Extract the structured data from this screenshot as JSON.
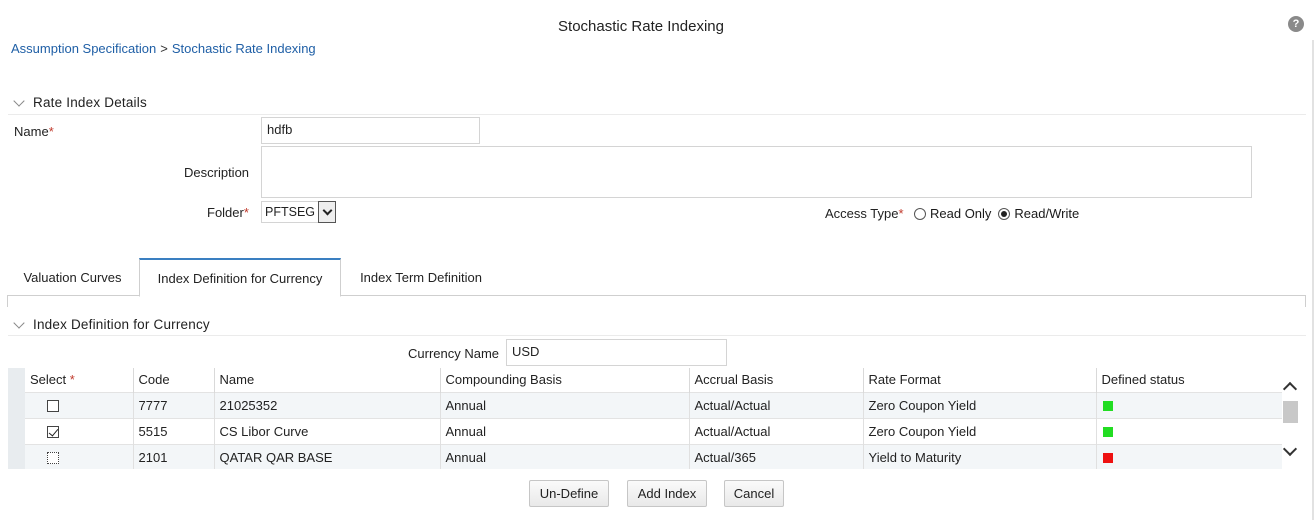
{
  "page": {
    "title": "Stochastic Rate Indexing",
    "help_icon": "?"
  },
  "breadcrumb": {
    "items": [
      "Assumption Specification",
      "Stochastic Rate Indexing"
    ],
    "separator": ">"
  },
  "rate_index_details": {
    "header": "Rate Index Details",
    "name_label": "Name",
    "name_value": "hdfb",
    "description_label": "Description",
    "description_value": "",
    "folder_label": "Folder",
    "folder_value": "PFTSEG",
    "access_type_label": "Access Type",
    "access_options": [
      "Read Only",
      "Read/Write"
    ],
    "access_selected": "Read/Write",
    "required_marker": "*"
  },
  "tabs": [
    {
      "label": "Valuation Curves",
      "active": false
    },
    {
      "label": "Index Definition for Currency",
      "active": true
    },
    {
      "label": "Index Term Definition",
      "active": false
    }
  ],
  "index_definition": {
    "header": "Index Definition for Currency",
    "currency_label": "Currency Name",
    "currency_value": "USD",
    "columns": [
      "Select",
      "Code",
      "Name",
      "Compounding Basis",
      "Accrual Basis",
      "Rate Format",
      "Defined status"
    ],
    "rows": [
      {
        "selected": false,
        "code": "7777",
        "name": "21025352",
        "compounding": "Annual",
        "accrual": "Actual/Actual",
        "rate_format": "Zero Coupon Yield",
        "status_color": "#22dd22"
      },
      {
        "selected": true,
        "code": "5515",
        "name": "CS Libor Curve",
        "compounding": "Annual",
        "accrual": "Actual/Actual",
        "rate_format": "Zero Coupon Yield",
        "status_color": "#22dd22"
      },
      {
        "selected": false,
        "code": "2101",
        "name": "QATAR QAR BASE",
        "compounding": "Annual",
        "accrual": "Actual/365",
        "rate_format": "Yield to Maturity",
        "status_color": "#ee1111"
      }
    ]
  },
  "buttons": {
    "undefine": "Un-Define",
    "add_index": "Add Index",
    "cancel": "Cancel"
  }
}
